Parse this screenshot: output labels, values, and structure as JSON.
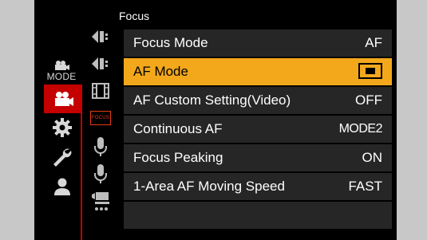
{
  "header": {
    "title": "Focus"
  },
  "tabs": {
    "mode_label": "MODE"
  },
  "subtabs": {
    "focus_label": "FOCUS"
  },
  "menu": {
    "items": [
      {
        "label": "Focus Mode",
        "value": "AF"
      },
      {
        "label": "AF Mode",
        "value": "",
        "selected": true,
        "value_icon": "single-area-af-icon"
      },
      {
        "label": "AF Custom Setting(Video)",
        "value": "OFF"
      },
      {
        "label": "Continuous AF",
        "value": "MODE2"
      },
      {
        "label": "Focus Peaking",
        "value": "ON"
      },
      {
        "label": "1-Area AF Moving Speed",
        "value": "FAST"
      }
    ]
  },
  "colors": {
    "accent": "#f3a81c",
    "tab_red": "#c40000",
    "row_bg": "#262626",
    "focus_red": "#e53a1a"
  }
}
